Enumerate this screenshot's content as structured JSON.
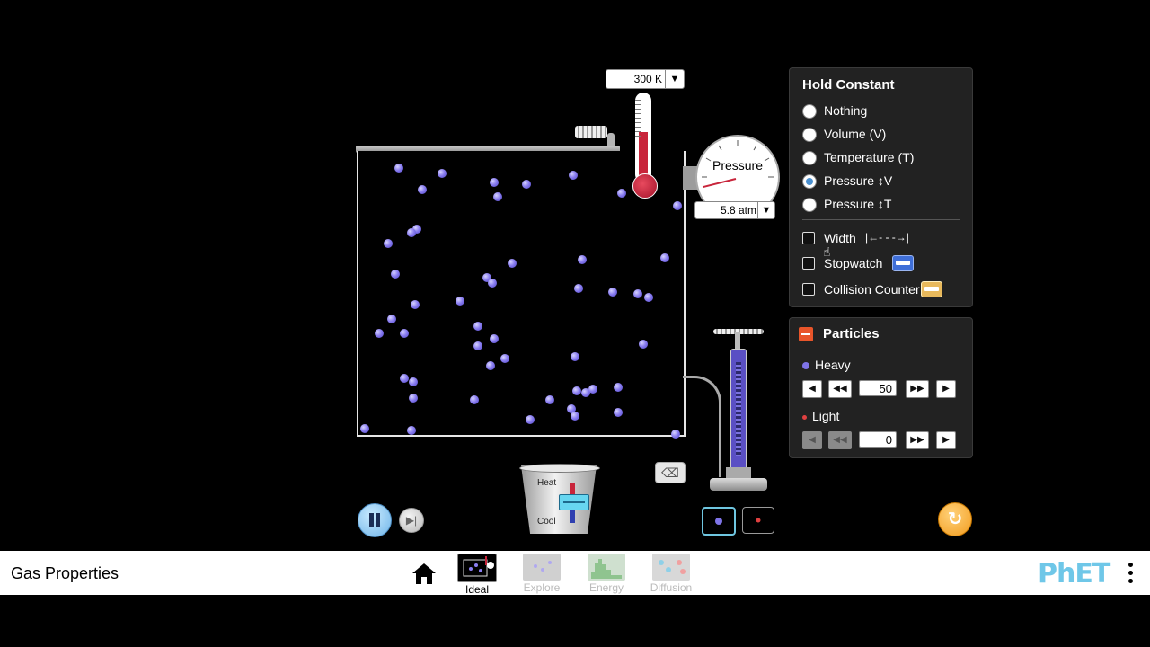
{
  "thermometer": {
    "value": "300 K",
    "dropdown_icon": "triangle-down"
  },
  "gauge": {
    "label": "Pressure",
    "value": "5.8 atm",
    "dropdown_icon": "triangle-down"
  },
  "heater": {
    "heat_label": "Heat",
    "cool_label": "Cool"
  },
  "hold_constant": {
    "title": "Hold Constant",
    "options": [
      {
        "label": "Nothing",
        "selected": false
      },
      {
        "label": "Volume (V)",
        "selected": false
      },
      {
        "label": "Temperature (T)",
        "selected": false
      },
      {
        "label": "Pressure ↕V",
        "selected": true
      },
      {
        "label": "Pressure ↕T",
        "selected": false
      }
    ],
    "tools": [
      {
        "label": "Width",
        "checked": false,
        "icon": "width-arrows"
      },
      {
        "label": "Stopwatch",
        "checked": false,
        "icon": "stopwatch"
      },
      {
        "label": "Collision Counter",
        "checked": false,
        "icon": "collision-counter"
      }
    ],
    "width_icon_text": "|←- - -→|"
  },
  "particles": {
    "title": "Particles",
    "heavy": {
      "label": "Heavy",
      "value": "50",
      "color": "#7f74e8"
    },
    "light": {
      "label": "Light",
      "value": "0",
      "color": "#e04040"
    }
  },
  "colors": {
    "accent": "#6fc7e8",
    "reset": "#f29b1d",
    "container_border": "#e6e6e6"
  },
  "navbar": {
    "app_title": "Gas Properties",
    "screens": [
      {
        "label": "Ideal",
        "active": true
      },
      {
        "label": "Explore",
        "active": false
      },
      {
        "label": "Energy",
        "active": false
      },
      {
        "label": "Diffusion",
        "active": false
      }
    ],
    "logo": "PhET"
  }
}
